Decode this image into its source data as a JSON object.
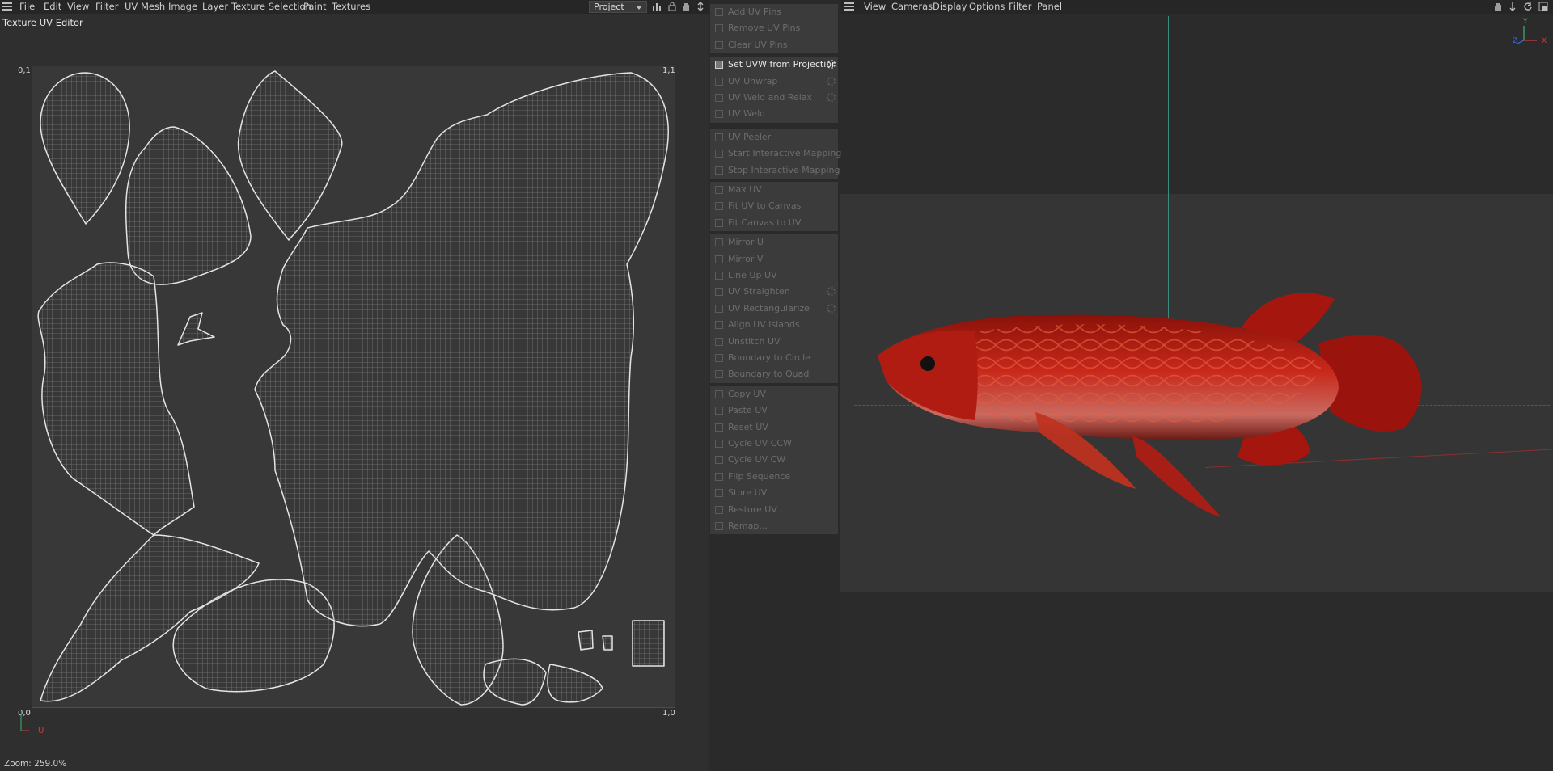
{
  "uv_editor": {
    "menu": [
      "File",
      "Edit",
      "View",
      "Filter",
      "UV Mesh",
      "Image",
      "Layer",
      "Texture Selection",
      "Paint",
      "Textures"
    ],
    "project_select": "Project",
    "title": "Texture UV Editor",
    "corners": {
      "top_left": "0,1",
      "top_right": "1,1",
      "bottom_left": "0,0",
      "bottom_right": "1,0"
    },
    "axis_label": "U",
    "zoom": "Zoom: 259.0%"
  },
  "commands": {
    "groups": [
      [
        "Add UV Pins",
        "Remove UV Pins",
        "Clear UV Pins"
      ],
      [
        "Set UVW from Projection",
        "UV Unwrap",
        "UV Weld and Relax",
        "UV Weld"
      ],
      [
        "UV Peeler",
        "Start Interactive Mapping",
        "Stop Interactive Mapping"
      ],
      [
        "Max UV",
        "Fit UV to Canvas",
        "Fit Canvas to UV"
      ],
      [
        "Mirror U",
        "Mirror V",
        "Line Up UV",
        "UV Straighten",
        "UV Rectangularize",
        "Align UV Islands",
        "Unstitch UV",
        "Boundary to Circle",
        "Boundary to Quad"
      ],
      [
        "Copy UV",
        "Paste UV",
        "Reset UV",
        "Cycle UV CCW",
        "Cycle UV CW",
        "Flip Sequence",
        "Store UV",
        "Restore UV",
        "Remap..."
      ]
    ],
    "active": "Set UVW from Projection",
    "with_settings": [
      "Set UVW from Projection",
      "UV Unwrap",
      "UV Weld and Relax",
      "UV Straighten",
      "UV Rectangularize"
    ]
  },
  "viewport": {
    "menu": [
      "View",
      "Cameras",
      "Display",
      "Options",
      "Filter",
      "Panel"
    ],
    "axis_labels": {
      "y": "Y",
      "z": "Z",
      "x": "X"
    }
  },
  "colors": {
    "fish_red": "#b3180f",
    "uv_wire": "#dcdcdc",
    "axis_green": "#3db36e",
    "axis_red": "#d23b3b",
    "axis_blue": "#3a6fd6"
  }
}
